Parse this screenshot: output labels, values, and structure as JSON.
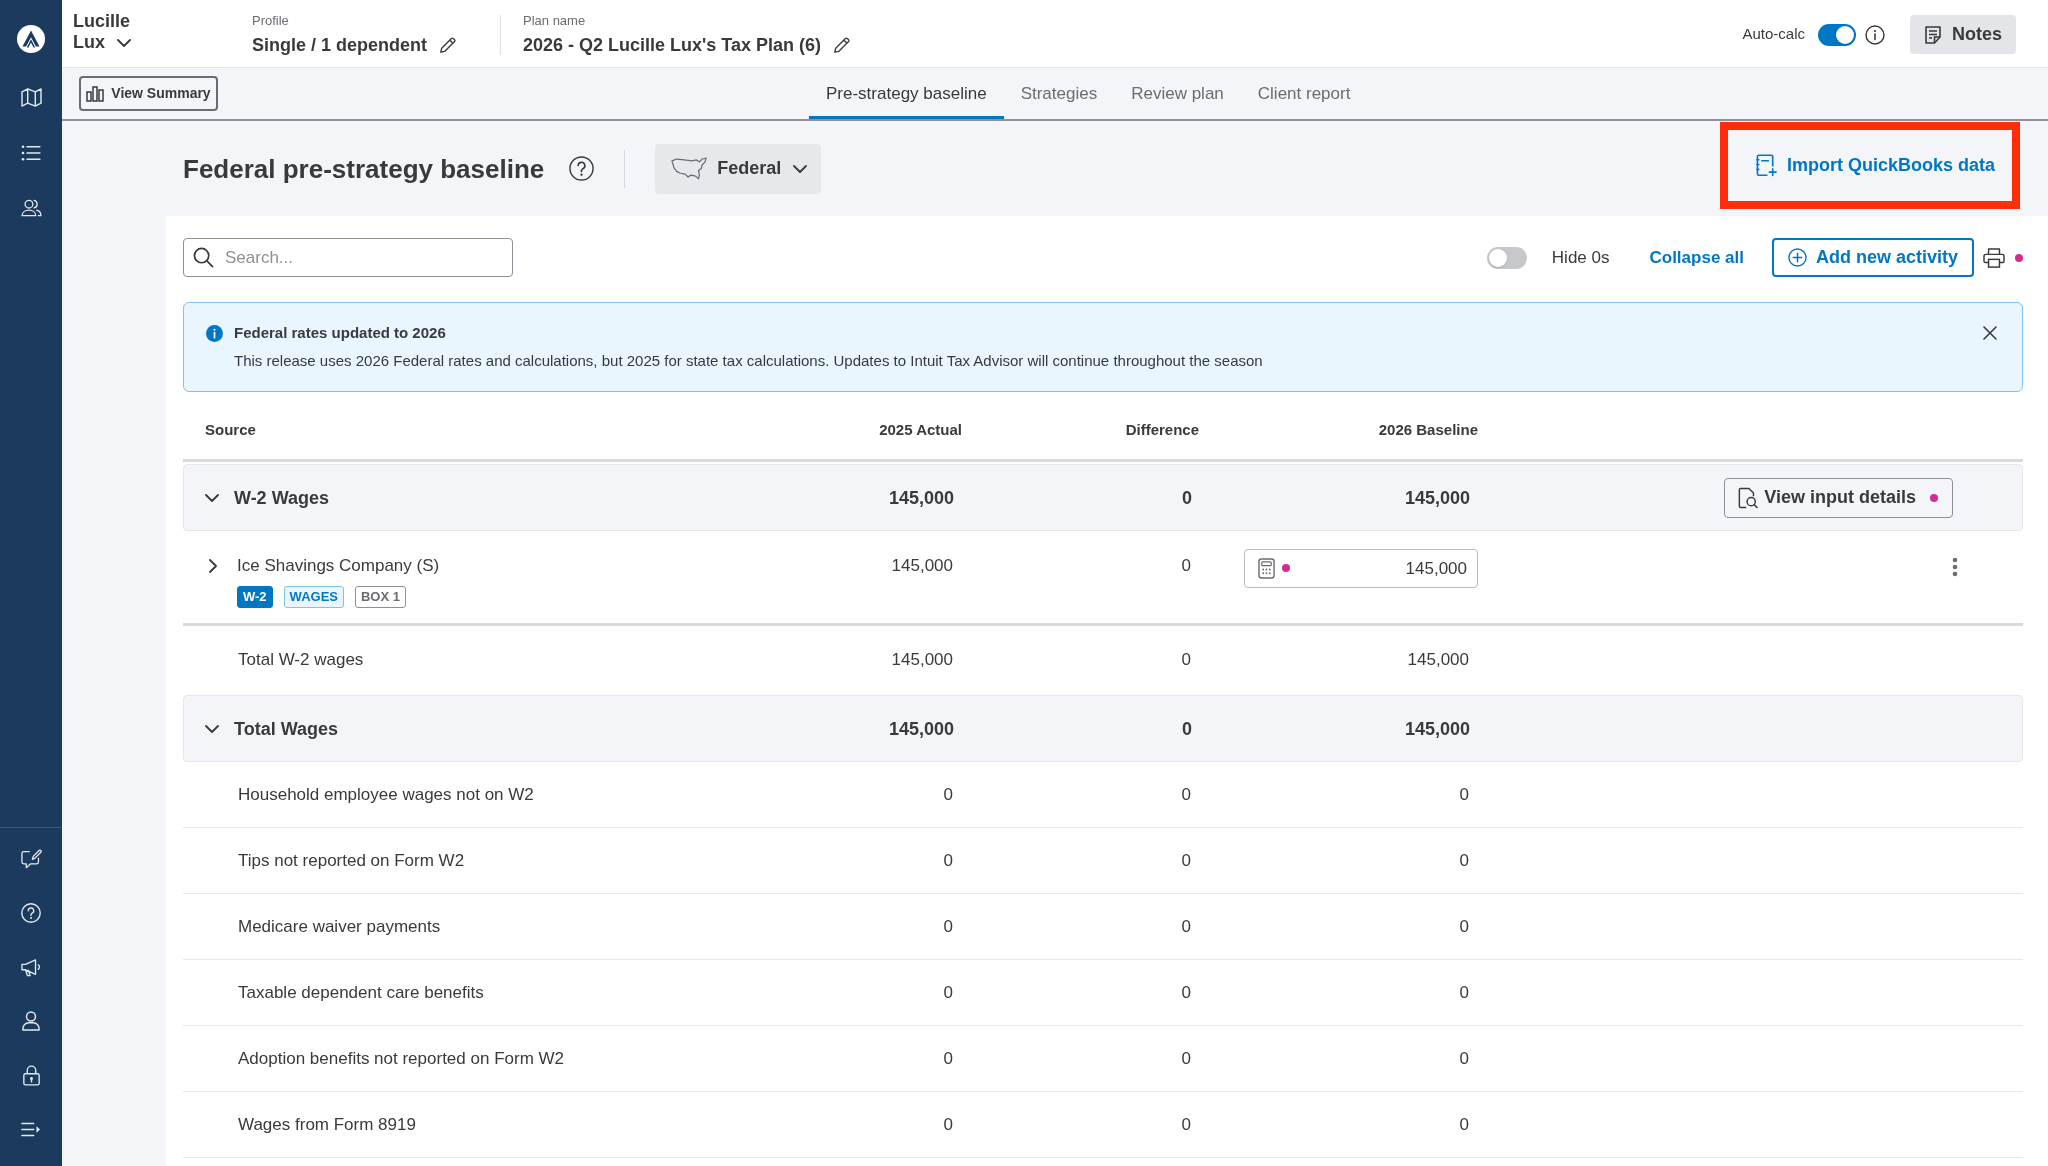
{
  "client": {
    "first_name": "Lucille",
    "last_name": "Lux"
  },
  "profile": {
    "label": "Profile",
    "value": "Single / 1 dependent"
  },
  "plan": {
    "label": "Plan name",
    "value": "2026 - Q2 Lucille Lux's Tax Plan (6)"
  },
  "auto_calc": {
    "label": "Auto-calc",
    "on": true
  },
  "notes_button": {
    "label": "Notes"
  },
  "view_summary_button": {
    "label": "View Summary"
  },
  "tabs": [
    {
      "label": "Pre-strategy baseline",
      "selected": true
    },
    {
      "label": "Strategies",
      "selected": false
    },
    {
      "label": "Review plan",
      "selected": false
    },
    {
      "label": "Client report",
      "selected": false
    }
  ],
  "page_title": "Federal pre-strategy baseline",
  "jurisdiction_dropdown": {
    "value": "Federal"
  },
  "import_button": {
    "label": "Import QuickBooks data",
    "highlighted": true
  },
  "search": {
    "placeholder": "Search..."
  },
  "hide_zeros": {
    "label": "Hide 0s",
    "on": false
  },
  "collapse_all": {
    "label": "Collapse all"
  },
  "add_activity_button": {
    "label": "Add new activity"
  },
  "print": {
    "flagged": true
  },
  "banner": {
    "title": "Federal rates updated to 2026",
    "message": "This release uses 2026 Federal rates and calculations, but 2025 for state tax calculations. Updates to Intuit Tax Advisor will continue throughout the season"
  },
  "table": {
    "columns": [
      "Source",
      "2025 Actual",
      "Difference",
      "2026 Baseline"
    ],
    "sections": [
      {
        "title": "W-2 Wages",
        "expanded": true,
        "values": [
          "145,000",
          "0",
          "145,000"
        ],
        "action": {
          "label": "View input details",
          "flagged": true
        },
        "rows": [
          {
            "kind": "source",
            "label": "Ice Shavings Company (S)",
            "expanded": false,
            "tags": [
              {
                "text": "W-2",
                "kind": "filled"
              },
              {
                "text": "WAGES",
                "kind": "tinted"
              },
              {
                "text": "BOX 1",
                "kind": "outline"
              }
            ],
            "values": [
              "145,000",
              "0"
            ],
            "input": {
              "value": "145,000",
              "flagged": true
            }
          },
          {
            "kind": "subtotal",
            "label": "Total W-2 wages",
            "values": [
              "145,000",
              "0",
              "145,000"
            ]
          }
        ]
      },
      {
        "title": "Total Wages",
        "expanded": true,
        "values": [
          "145,000",
          "0",
          "145,000"
        ],
        "rows": [
          {
            "kind": "line",
            "label": "Household employee wages not on W2",
            "values": [
              "0",
              "0",
              "0"
            ]
          },
          {
            "kind": "line",
            "label": "Tips not reported on Form W2",
            "values": [
              "0",
              "0",
              "0"
            ]
          },
          {
            "kind": "line",
            "label": "Medicare waiver payments",
            "values": [
              "0",
              "0",
              "0"
            ]
          },
          {
            "kind": "line",
            "label": "Taxable dependent care benefits",
            "values": [
              "0",
              "0",
              "0"
            ]
          },
          {
            "kind": "line",
            "label": "Adoption benefits not reported on Form W2",
            "values": [
              "0",
              "0",
              "0"
            ]
          },
          {
            "kind": "line",
            "label": "Wages from Form 8919",
            "values": [
              "0",
              "0",
              "0"
            ]
          }
        ]
      }
    ]
  }
}
